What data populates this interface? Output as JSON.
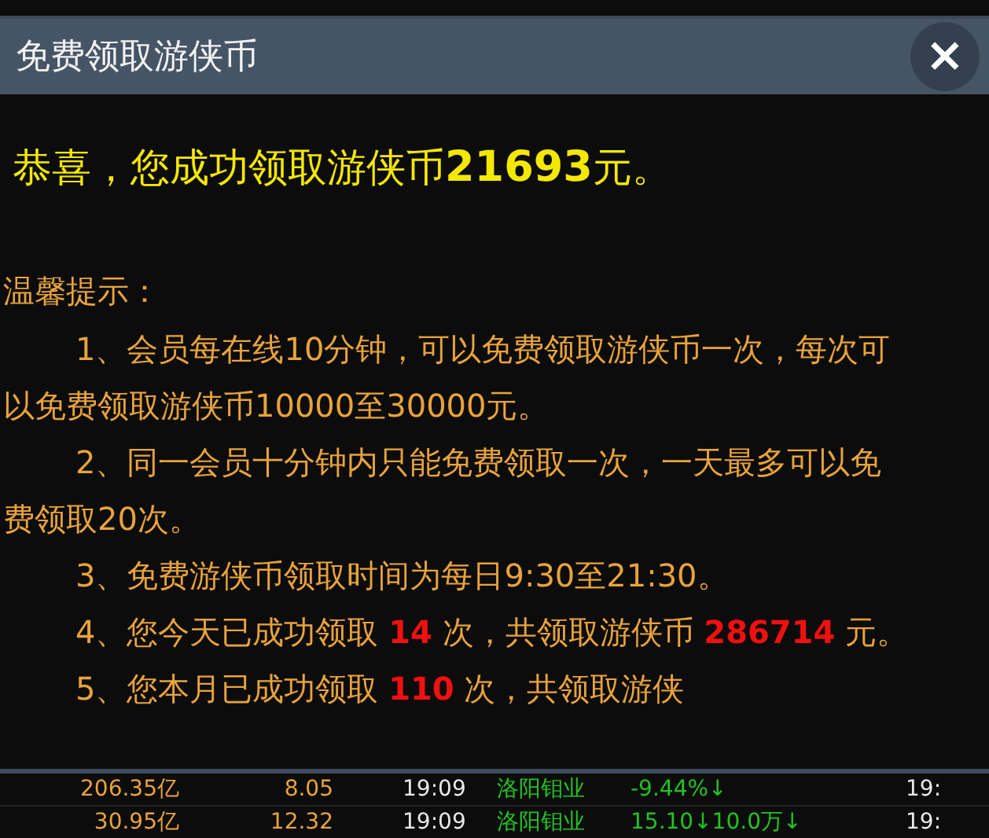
{
  "dialog": {
    "title": "免费领取游侠币",
    "close_label": "×",
    "headline": "恭喜，您成功领取游侠币**21693**元。",
    "tips_title": "温馨提示：",
    "tips": [
      "1、会员每在线10分钟，可以免费领取游侠币一次，每次可以免费领取游侠币10000至30000元。",
      "2、同一会员十分钟内只能免费领取一次，一天最多可以免费领取20次。",
      "3、免费游侠币领取时间为每日9:30至21:30。",
      "4、您今天已成功领取 **14** 次，共领取游侠币 **286714** 元。",
      "5、您本月已成功领取 **110** 次，共领取游侠"
    ]
  },
  "background_table": {
    "rows": [
      [
        "206.35亿",
        "8.05",
        "19:09",
        "洛阳钼业",
        "-9.44%↓",
        "19:"
      ],
      [
        "30.95亿",
        "12.32",
        "19:09",
        "洛阳钼业",
        "15.10↓10.0万↓",
        "19:"
      ]
    ]
  }
}
